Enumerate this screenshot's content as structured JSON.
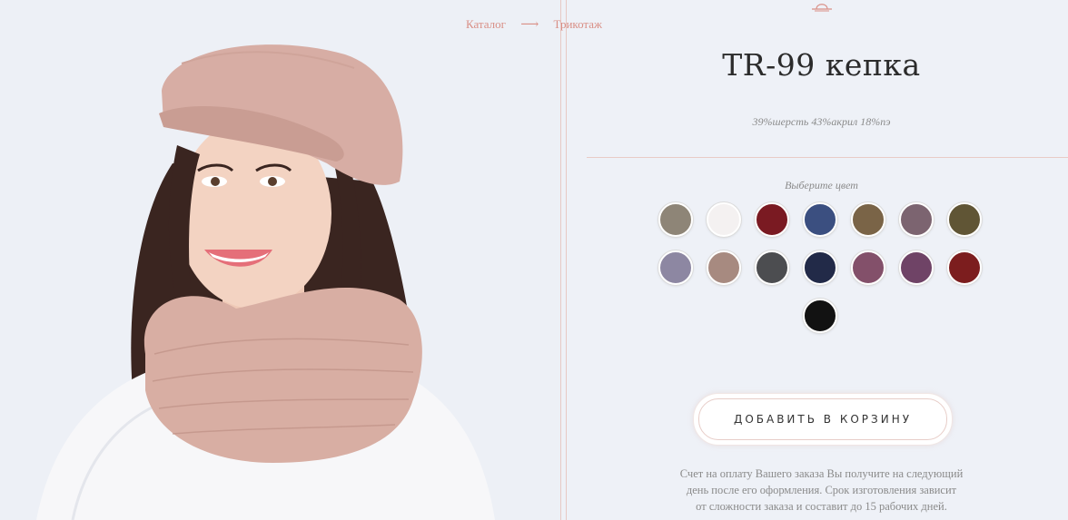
{
  "breadcrumb": {
    "items": [
      "Каталог",
      "Трикотаж"
    ],
    "separator": "⟶"
  },
  "product": {
    "title": "TR-99 кепка",
    "composition": "39%шерсть 43%акрил 18%пэ",
    "photo": "model-in-pink-knit-cap-and-snood"
  },
  "colors": {
    "label": "Выберите цвет",
    "swatches": [
      "#8e8577",
      "#f4f1f1",
      "#7a1a22",
      "#3b4f80",
      "#7a6447",
      "#7c6470",
      "#605535",
      "#8d87a2",
      "#a78a80",
      "#4c4d50",
      "#222a48",
      "#83506a",
      "#6f4366",
      "#7c1d1e",
      "#121212"
    ]
  },
  "cart": {
    "label": "ДОБАВИТЬ В КОРЗИНУ"
  },
  "note": {
    "lines": [
      "Счет на оплату Вашего заказа Вы получите на следующий",
      "день после его оформления. Срок изготовления зависит",
      "от сложности заказа и составит до 15 рабочих дней."
    ]
  }
}
